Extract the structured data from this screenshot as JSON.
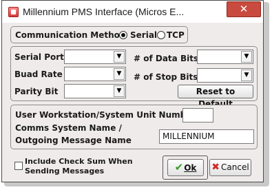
{
  "window": {
    "title": "Millennium PMS Interface (Micros E...",
    "close_glyph": "✕",
    "icon": "app-icon"
  },
  "communication": {
    "label": "Communication Method",
    "options": [
      {
        "label": "Serial",
        "selected": true
      },
      {
        "label": "TCP",
        "selected": false
      }
    ]
  },
  "serial": {
    "port_label": "Serial Port",
    "port_value": "",
    "baud_label": "Buad Rate",
    "baud_value": "",
    "parity_label": "Parity Bit",
    "parity_value": "",
    "data_bits_label": "# of Data Bits",
    "data_bits_value": "",
    "stop_bits_label": "# of Stop Bits",
    "stop_bits_value": "",
    "reset_label": "Reset to Default",
    "dropdown_glyph": "▼"
  },
  "system": {
    "workstation_label": "User Workstation/System Unit Number",
    "workstation_value": "",
    "comms_name_label_line1": "Comms System Name /",
    "comms_name_label_line2": "Outgoing Message Name",
    "comms_name_value": "MILLENNIUM"
  },
  "footer": {
    "checksum_label_line1": "Include Check Sum When",
    "checksum_label_line2": "Sending Messages",
    "checksum_checked": false,
    "ok_label": "Ok",
    "ok_glyph": "✔",
    "cancel_label": "Cancel",
    "cancel_glyph": "✖"
  },
  "colors": {
    "close_red": "#c94a3e",
    "ok_check_green": "#3a9a2a",
    "cancel_red": "#d22a2a",
    "dialog_bg": "#f0ebeb"
  }
}
